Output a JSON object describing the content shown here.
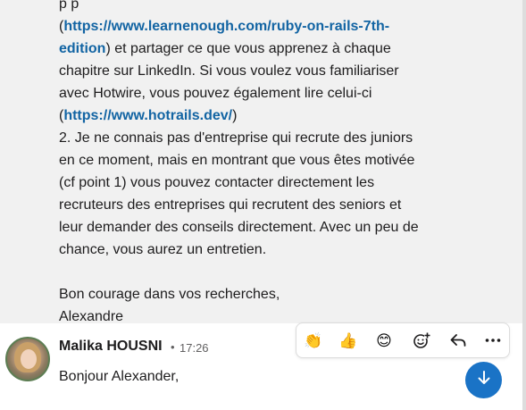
{
  "previous_message": {
    "lines": [
      {
        "type": "partial",
        "text": "p            p"
      },
      {
        "type": "mixed",
        "parts": [
          {
            "kind": "text",
            "text": "("
          },
          {
            "kind": "link",
            "text": "https://www.learnenough.com/ruby-on-rails-7th-"
          }
        ]
      },
      {
        "type": "mixed",
        "parts": [
          {
            "kind": "link",
            "text": "edition"
          },
          {
            "kind": "text",
            "text": ") et partager ce que vous apprenez à chaque"
          }
        ]
      },
      {
        "type": "text",
        "text": "chapitre sur LinkedIn. Si vous voulez vous familiariser"
      },
      {
        "type": "text",
        "text": "avec Hotwire, vous pouvez également lire celui-ci"
      },
      {
        "type": "mixed",
        "parts": [
          {
            "kind": "text",
            "text": "("
          },
          {
            "kind": "link",
            "text": "https://www.hotrails.dev/"
          },
          {
            "kind": "text",
            "text": ")"
          }
        ]
      },
      {
        "type": "text",
        "text": "2. Je ne connais pas d'entreprise qui recrute des juniors"
      },
      {
        "type": "text",
        "text": "en ce moment, mais en montrant que vous êtes motivée"
      },
      {
        "type": "text",
        "text": "(cf point 1) vous pouvez contacter directement les"
      },
      {
        "type": "text",
        "text": "recruteurs des entreprises qui recrutent des seniors et"
      },
      {
        "type": "text",
        "text": "leur demander des conseils directement. Avec un peu de"
      },
      {
        "type": "text",
        "text": "chance, vous aurez un entretien."
      },
      {
        "type": "blank"
      },
      {
        "type": "text",
        "text": "Bon courage dans vos recherches,"
      },
      {
        "type": "text",
        "text": "Alexandre"
      }
    ]
  },
  "message": {
    "author": "Malika HOUSNI",
    "separator": "•",
    "time": "17:26",
    "text": "Bonjour Alexander,"
  },
  "toolbar": {
    "actions": [
      {
        "name": "clap-reaction",
        "icon": "clapping-hands-icon",
        "glyph": "👏"
      },
      {
        "name": "thumbs-up-reaction",
        "icon": "thumbs-up-icon",
        "glyph": "👍"
      },
      {
        "name": "smile-reaction",
        "icon": "smiling-face-icon",
        "glyph": "😊"
      },
      {
        "name": "add-reaction",
        "icon": "add-emoji-icon"
      },
      {
        "name": "reply",
        "icon": "reply-arrow-icon"
      },
      {
        "name": "more-actions",
        "icon": "more-dots-icon"
      }
    ]
  },
  "colors": {
    "link": "#1264a3",
    "highlight_background": "#f1f1f1",
    "jump_button": "#1a73c6"
  },
  "jump_button": {
    "icon": "arrow-down-icon"
  }
}
